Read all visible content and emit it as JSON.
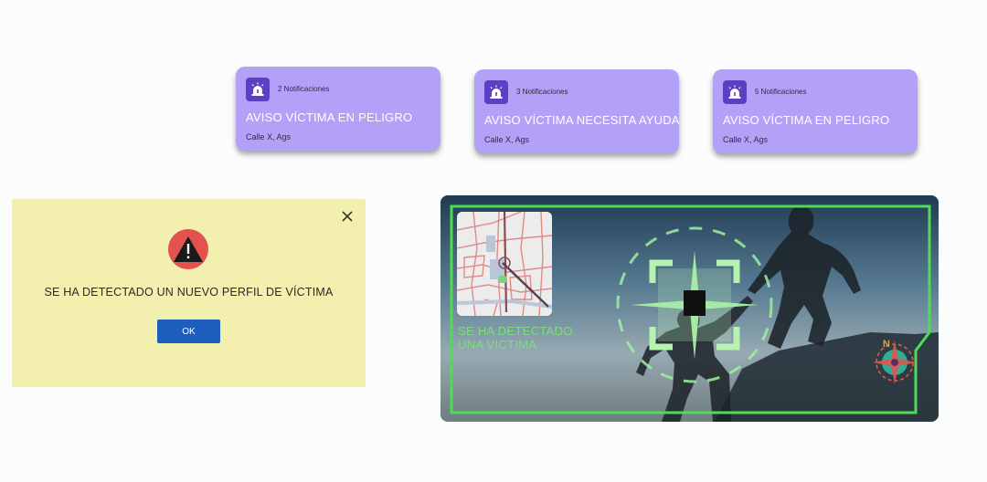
{
  "notifications": [
    {
      "count": "2 Notificaciones",
      "title": "AVISO VÍCTIMA EN PELIGRO",
      "location": "Calle X, Ags"
    },
    {
      "count": "3 Notificaciones",
      "title": "AVISO VÍCTIMA NECESITA AYUDA",
      "location": "Calle X, Ags"
    },
    {
      "count": "5 Notificaciones",
      "title": "AVISO VÍCTIMA EN PELIGRO",
      "location": "Calle X, Ags"
    }
  ],
  "dialog": {
    "message": "SE HA DETECTADO UN NUEVO PERFIL DE VÍCTIMA",
    "ok_label": "OK",
    "close_icon": "close-icon",
    "warning_icon": "warning-icon"
  },
  "scene": {
    "detection_line1": "SE HA DETECTADO",
    "detection_line2": "UNA VICTIMA",
    "compass_label": "N",
    "map_icon": "map-thumbnail",
    "reticle_icon": "target-reticle-icon",
    "compass_icon": "compass-icon"
  },
  "colors": {
    "card_bg": "#b3a1f7",
    "card_icon_bg": "#5c3fc4",
    "dialog_bg": "#f3efaf",
    "ok_button": "#1e5fbd",
    "warning_red": "#e4524f",
    "hud_green": "#7fdc82"
  }
}
